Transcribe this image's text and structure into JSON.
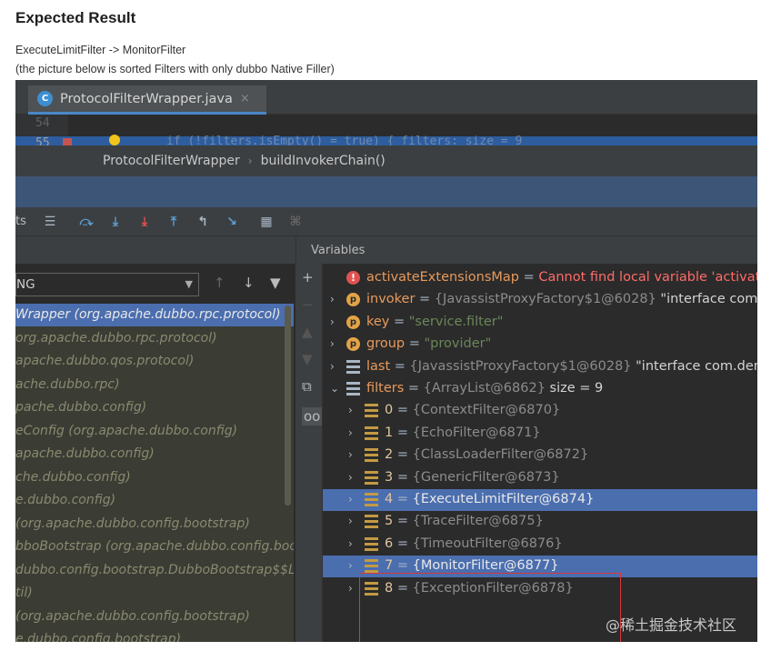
{
  "doc": {
    "heading": "Expected Result",
    "line1": "ExecuteLimitFilter -> MonitorFilter",
    "line2": "(the picture below is sorted Filters with only dubbo Native Filler)"
  },
  "editor": {
    "tab_label": "ProtocolFilterWrapper.java",
    "tab_close": "×",
    "line_54": "54",
    "line_55": "55",
    "code_55": "if (!filters.isEmpty() = true) {   filters:  size = 9",
    "breadcrumb": [
      "ProtocolFilterWrapper",
      "buildInvokerChain()"
    ]
  },
  "debugger": {
    "toolbar_left_text": "ts",
    "thread_selected": "NG",
    "variables_title": "Variables",
    "frames": [
      {
        "text": "Wrapper (org.apache.dubbo.rpc.protocol)",
        "selected": true
      },
      {
        "text": "org.apache.dubbo.rpc.protocol)",
        "selected": false
      },
      {
        "text": "apache.dubbo.qos.protocol)",
        "selected": false
      },
      {
        "text": "ache.dubbo.rpc)",
        "selected": false
      },
      {
        "text": "pache.dubbo.config)",
        "selected": false
      },
      {
        "text": "eConfig (org.apache.dubbo.config)",
        "selected": false
      },
      {
        "text": "apache.dubbo.config)",
        "selected": false
      },
      {
        "text": "che.dubbo.config)",
        "selected": false
      },
      {
        "text": "e.dubbo.config)",
        "selected": false
      },
      {
        "text": " (org.apache.dubbo.config.bootstrap)",
        "selected": false
      },
      {
        "text": "bboBootstrap (org.apache.dubbo.config.boo",
        "selected": false
      },
      {
        "text": "dubbo.config.bootstrap.DubboBootstrap$$L",
        "selected": false
      },
      {
        "text": "til)",
        "selected": false
      },
      {
        "text": " (org.apache.dubbo.config.bootstrap)",
        "selected": false
      },
      {
        "text": "e.dubbo.config.bootstrap)",
        "selected": false
      }
    ],
    "variables": [
      {
        "icon": "err",
        "name": "activateExtensionsMap",
        "eq": " = ",
        "value": "Cannot find local variable 'activate",
        "style": "errt",
        "expand": "",
        "indent": 0
      },
      {
        "icon": "prm",
        "name": "invoker",
        "eq": " = ",
        "value": "{JavassistProxyFactory$1@6028} ",
        "extra": "\"interface com.de",
        "expand": ">",
        "indent": 0
      },
      {
        "icon": "prm",
        "name": "key",
        "eq": " = ",
        "value": "\"service.filter\"",
        "style": "str",
        "expand": ">",
        "indent": 0
      },
      {
        "icon": "prm",
        "name": "group",
        "eq": " = ",
        "value": "\"provider\"",
        "style": "str",
        "expand": ">",
        "indent": 0
      },
      {
        "icon": "fld",
        "name": "last",
        "eq": " = ",
        "value": "{JavassistProxyFactory$1@6028} ",
        "extra": "\"interface com.demo.",
        "expand": ">",
        "indent": 0
      },
      {
        "icon": "fld",
        "name": "filters",
        "eq": " = ",
        "value": "{ArrayList@6862} ",
        "extra": " size = 9",
        "expand": "v",
        "indent": 0
      },
      {
        "icon": "lst",
        "name": "0",
        "eq": " = ",
        "value": "{ContextFilter@6870}",
        "expand": ">",
        "indent": 1
      },
      {
        "icon": "lst",
        "name": "1",
        "eq": " = ",
        "value": "{EchoFilter@6871}",
        "expand": ">",
        "indent": 1
      },
      {
        "icon": "lst",
        "name": "2",
        "eq": " = ",
        "value": "{ClassLoaderFilter@6872}",
        "expand": ">",
        "indent": 1
      },
      {
        "icon": "lst",
        "name": "3",
        "eq": " = ",
        "value": "{GenericFilter@6873}",
        "expand": ">",
        "indent": 1
      },
      {
        "icon": "lst",
        "name": "4",
        "eq": " = ",
        "value": "{ExecuteLimitFilter@6874}",
        "expand": ">",
        "indent": 1,
        "selected": true
      },
      {
        "icon": "lst",
        "name": "5",
        "eq": " = ",
        "value": "{TraceFilter@6875}",
        "expand": ">",
        "indent": 1
      },
      {
        "icon": "lst",
        "name": "6",
        "eq": " = ",
        "value": "{TimeoutFilter@6876}",
        "expand": ">",
        "indent": 1
      },
      {
        "icon": "lst",
        "name": "7",
        "eq": " = ",
        "value": "{MonitorFilter@6877}",
        "expand": ">",
        "indent": 1,
        "selected": true
      },
      {
        "icon": "lst",
        "name": "8",
        "eq": " = ",
        "value": "{ExceptionFilter@6878}",
        "expand": ">",
        "indent": 1
      }
    ]
  },
  "watermark": "@稀土掘金技术社区",
  "colors": {
    "selection": "#4b6eaf",
    "highlight_box": "#d9363e",
    "accent": "#4a88c7"
  }
}
